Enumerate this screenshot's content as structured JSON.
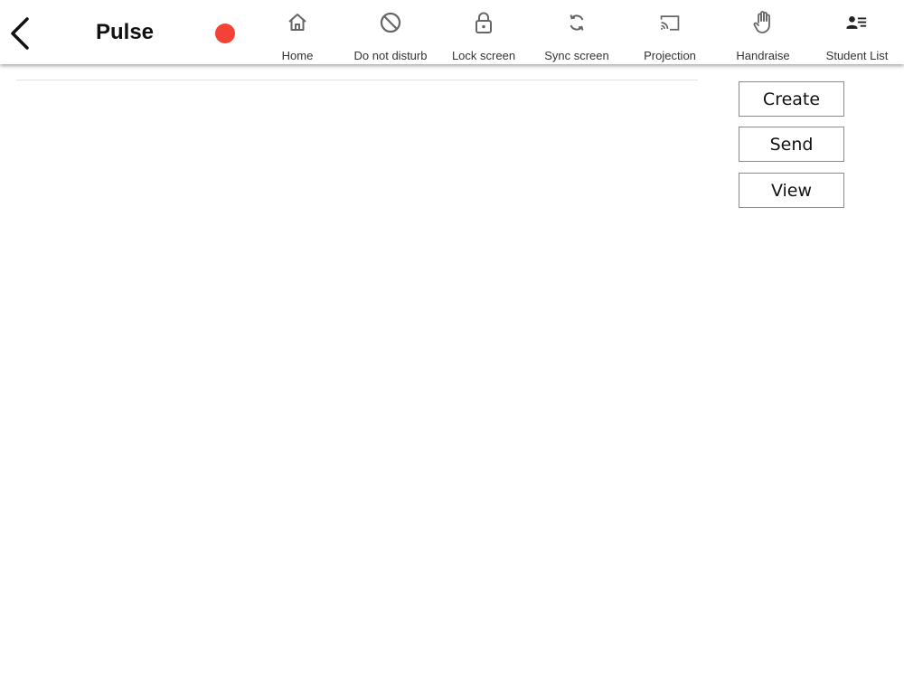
{
  "app": {
    "title": "Pulse"
  },
  "colors": {
    "recording_indicator": "#f44336",
    "icon": "#666666",
    "shadow": "#999999"
  },
  "nav": {
    "items": [
      {
        "label": "Home",
        "icon": "home-icon"
      },
      {
        "label": "Do not disturb",
        "icon": "do-not-disturb-icon"
      },
      {
        "label": "Lock screen",
        "icon": "lock-icon"
      },
      {
        "label": "Sync screen",
        "icon": "sync-icon"
      },
      {
        "label": "Projection",
        "icon": "cast-icon"
      },
      {
        "label": "Handraise",
        "icon": "hand-icon"
      },
      {
        "label": "Student List",
        "icon": "student-list-icon"
      }
    ]
  },
  "actions": {
    "create_label": "Create",
    "send_label": "Send",
    "view_label": "View"
  }
}
